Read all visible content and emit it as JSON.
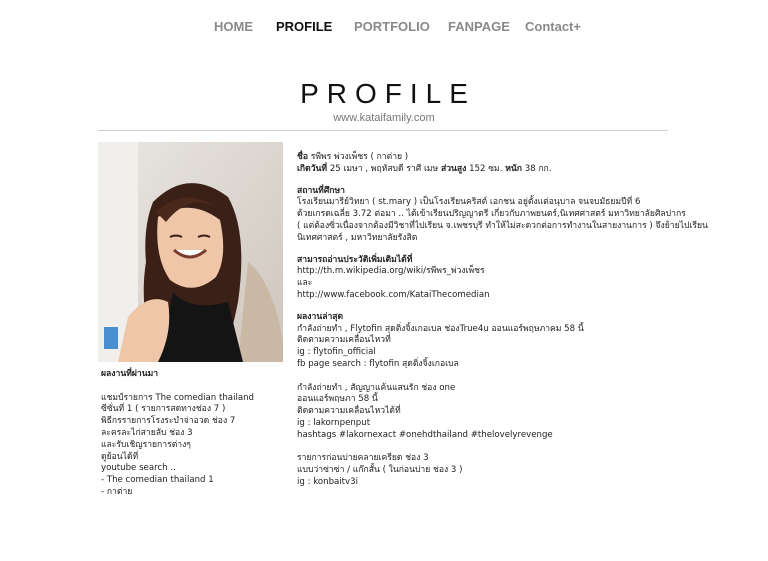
{
  "nav": {
    "items": [
      {
        "label": "HOME"
      },
      {
        "label": "PROFILE"
      },
      {
        "label": "PORTFOLIO"
      },
      {
        "label": "FANPAGE"
      },
      {
        "label": "Contact+"
      }
    ]
  },
  "header": {
    "title": "PROFILE",
    "url": "www.kataifamily.com"
  },
  "profile": {
    "name_label": "ชื่อ",
    "name_value": "รพีพร พ่วงเพ็ชร ( กาต่าย )",
    "birth_label": "เกิดวันที่",
    "birth_value": "25 เมษา , พฤหัสบดี ราศี เมษ",
    "height_label": "ส่วนสูง",
    "height_value": "152 ซม.",
    "weight_label": "หนัก",
    "weight_value": "38 กก."
  },
  "education": {
    "heading": "สถานที่ศึกษา",
    "lines": [
      "โรงเรียนมารีย์วิทยา ( st.mary ) เป็นโรงเรียนคริสต์ เอกชน อยู่ตั้งแต่อนุบาล จนจบมัธยมปีที่ 6",
      "ด้วยเกรดเฉลี่ย 3.72 ต่อมา .. ได้เข้าเรียนปริญญาตรี เกี่ยวกับภาพยนตร์,นิเทศศาสตร์ มหาวิทยาลัยศิลปากร",
      "( แต่ต้องซิ่วเนื่องจากต้องมีวิชาที่ไปเรียน จ.เพชรบุรี ทำให้ไม่สะดวกต่อการทำงานในสายงานการ ) จึงย้ายไปเรียน",
      "นิเทศศาสตร์ , มหาวิทยาลัยรังสิต"
    ]
  },
  "more_info": {
    "heading": "สามารถอ่านประวัติเพิ่มเติมได้ที่",
    "wiki": "http://th.m.wikipedia.org/wiki/รพีพร_พ่วงเพ็ชร",
    "and": "และ",
    "facebook": "http://www.facebook.com/KataiThecomedian"
  },
  "latest_work": {
    "heading": "ผลงานล่าสุด",
    "block1": [
      "กำลังถ่ายทำ , Flytofin สุดติ่งจิ้งเกอเบล ช่องTrue4u ออนแอร์พฤษภาคม 58 นี้",
      "ติดตามความเคลื่อนไหวที่",
      "ig : flytofin_official",
      "fb page search : flytofin สุดติ่งจิ้งเกอเบล"
    ],
    "block2": [
      "กำลังถ่ายทำ , สัญญาแค้นแสนรัก ช่อง one",
      "ออนแอร์พฤษภา 58 นี้",
      "ติดตามความเคลื่อนไหวได้ที่",
      "ig : lakornpenput",
      "hashtags #lakornexact #onehdthailand #thelovelyrevenge"
    ],
    "block3": [
      "รายการก่อนบ่ายคลายเครียด ช่อง 3",
      "แบบว่าซ่าซ่า / แก๊กสั้น ( ในก่อนบ่าย ช่อง 3 )",
      "ig : konbaitv3i"
    ]
  },
  "past_work": {
    "heading": "ผลงานที่ผ่านมา",
    "lines": [
      "แชมป์รายการ The comedian thailand",
      "ซีซั่นที่ 1 ( รายการสดทางช่อง 7 )",
      "พิธีกรรายการโรงระบำจ่าอวด ช่อง 7",
      "ละครละไก่สายลับ ช่อง 3",
      "และรับเชิญรายการต่างๆ",
      "ดูย้อนได้ที่",
      "youtube search ..",
      "- The comedian thailand 1",
      "- กาต่าย"
    ]
  }
}
